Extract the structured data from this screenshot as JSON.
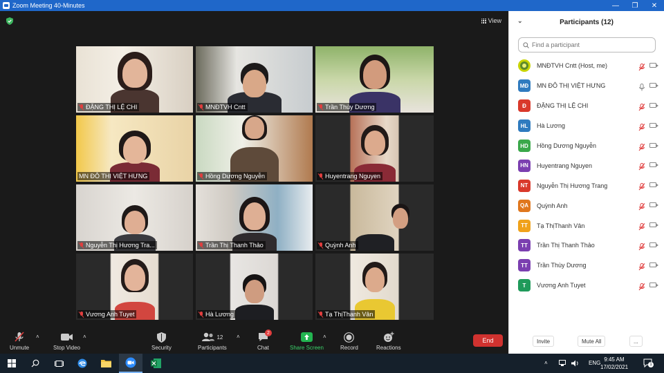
{
  "window": {
    "title": "Zoom Meeting 40-Minutes"
  },
  "main": {
    "view_label": "View"
  },
  "gallery": {
    "tiles": [
      {
        "name": "ĐẶNG THỊ LỆ CHI",
        "muted": true,
        "active": false
      },
      {
        "name": "MNĐTVH Cntt",
        "muted": true,
        "active": false
      },
      {
        "name": "Trần Thùy Dương",
        "muted": true,
        "active": true
      },
      {
        "name": "MN ĐÔ THỊ VIỆT HƯNG",
        "muted": false,
        "active": false
      },
      {
        "name": "Hồng Dương Nguyễn",
        "muted": true,
        "active": false
      },
      {
        "name": "Huyentrang Nguyen",
        "muted": true,
        "active": false
      },
      {
        "name": "Nguyễn Thị Hương Tra...",
        "muted": true,
        "active": false
      },
      {
        "name": "Trần Thị Thanh Thảo",
        "muted": true,
        "active": false
      },
      {
        "name": "Quỳnh Anh",
        "muted": true,
        "active": false
      },
      {
        "name": "Vương Anh Tuyet",
        "muted": true,
        "active": false
      },
      {
        "name": "Hà Lương",
        "muted": true,
        "active": false
      },
      {
        "name": "Tạ ThịThanh Vân",
        "muted": true,
        "active": false
      }
    ]
  },
  "toolbar": {
    "unmute": "Unmute",
    "stop_video": "Stop Video",
    "security": "Security",
    "participants": "Participants",
    "participants_count": "12",
    "chat": "Chat",
    "chat_badge": "2",
    "share_screen": "Share Screen",
    "record": "Record",
    "reactions": "Reactions",
    "end": "End"
  },
  "panel": {
    "title": "Participants (12)",
    "search_placeholder": "Find a participant",
    "participants": [
      {
        "initials": "",
        "name": "MNĐTVH Cntt (Host, me)",
        "color": "#c8d400",
        "mic": "muted"
      },
      {
        "initials": "MĐ",
        "name": "MN ĐÔ THỊ VIỆT HƯNG",
        "color": "#2f7bbf",
        "mic": "on"
      },
      {
        "initials": "Đ",
        "name": "ĐẶNG THỊ LỆ CHI",
        "color": "#d9392b",
        "mic": "muted"
      },
      {
        "initials": "HL",
        "name": "Hà Lương",
        "color": "#2f7bbf",
        "mic": "muted"
      },
      {
        "initials": "HD",
        "name": "Hồng Dương Nguyễn",
        "color": "#3aa84a",
        "mic": "muted"
      },
      {
        "initials": "HN",
        "name": "Huyentrang Nguyen",
        "color": "#7b3fb0",
        "mic": "muted"
      },
      {
        "initials": "NT",
        "name": "Nguyễn Thị Hương Trang",
        "color": "#d9392b",
        "mic": "muted"
      },
      {
        "initials": "QA",
        "name": "Quỳnh Anh",
        "color": "#e0771e",
        "mic": "muted"
      },
      {
        "initials": "TT",
        "name": "Tạ ThịThanh Vân",
        "color": "#f0a21b",
        "mic": "muted"
      },
      {
        "initials": "TT",
        "name": "Trần Thị Thanh Thảo",
        "color": "#7b3fb0",
        "mic": "muted"
      },
      {
        "initials": "TT",
        "name": "Trần Thùy Dương",
        "color": "#7b3fb0",
        "mic": "muted"
      },
      {
        "initials": "T",
        "name": "Vương Anh Tuyet",
        "color": "#1f9a5a",
        "mic": "muted"
      }
    ],
    "invite": "Invite",
    "mute_all": "Mute All",
    "more": "..."
  },
  "taskbar": {
    "language": "ENG",
    "time": "9:45 AM",
    "date": "17/02/2021",
    "notification_count": "1"
  }
}
